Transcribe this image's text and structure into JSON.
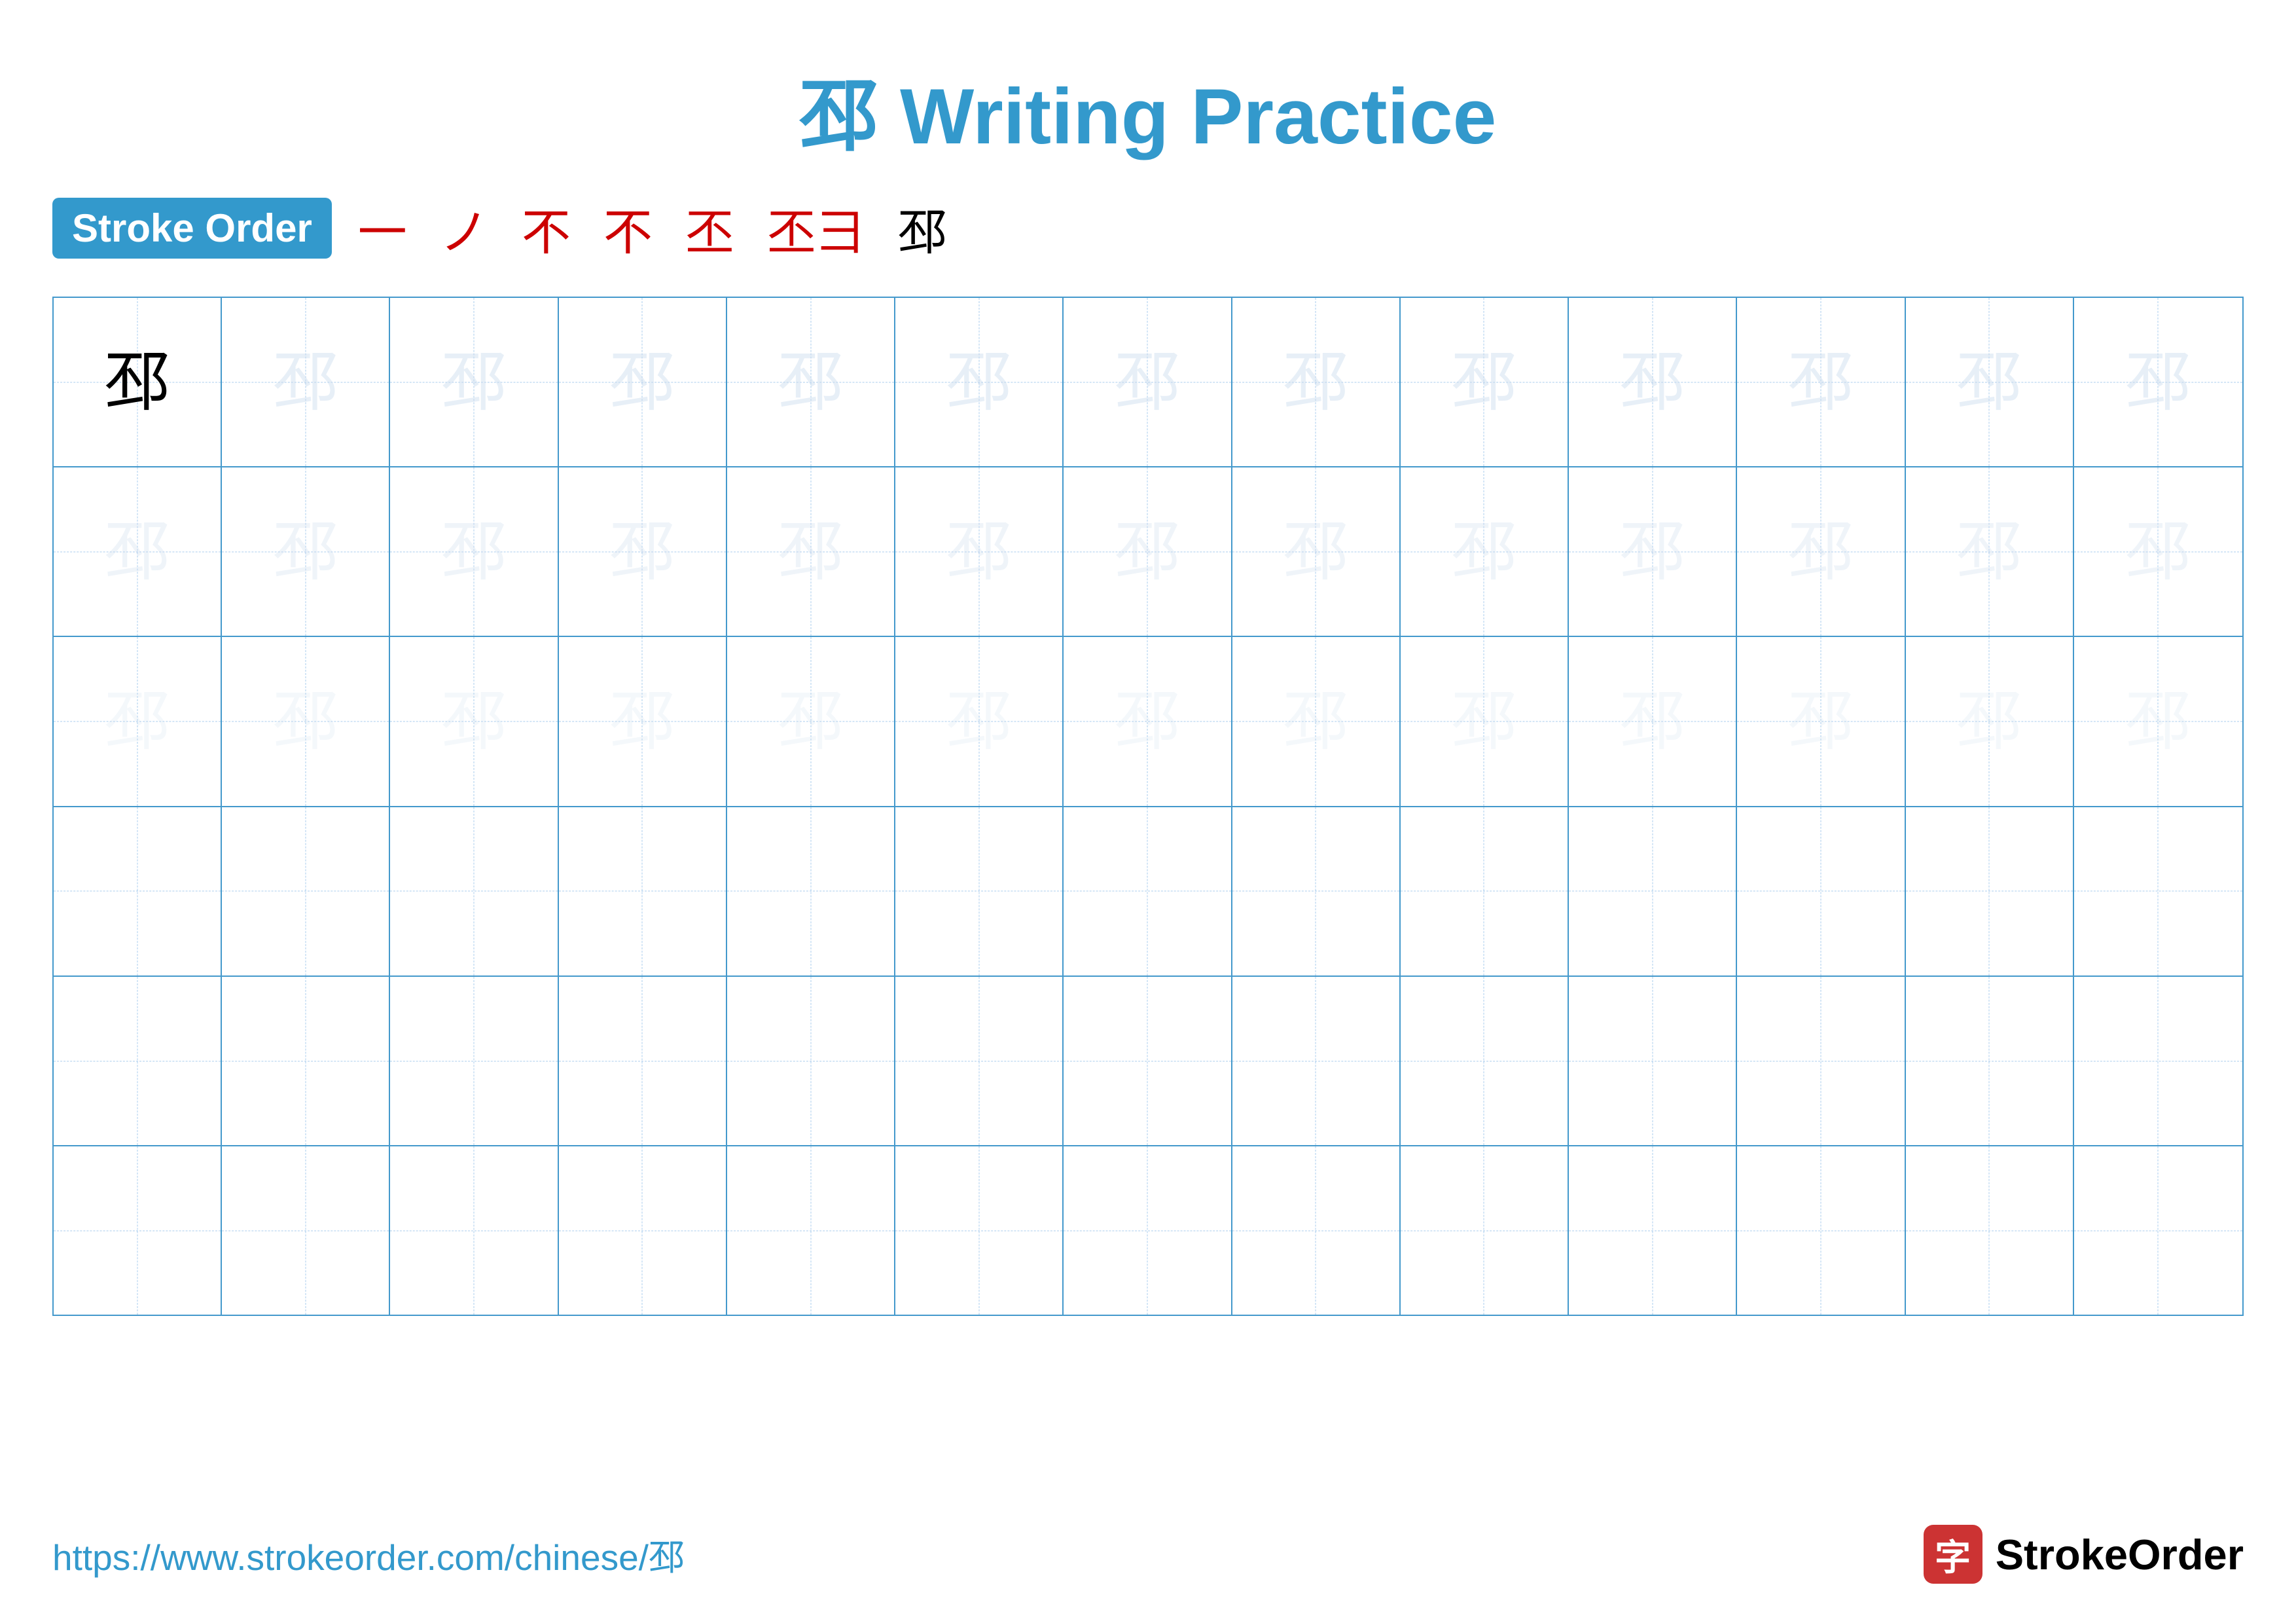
{
  "title": {
    "text": "邳 Writing Practice",
    "url": "https://www.strokeorder.com/chinese/邳"
  },
  "stroke_order": {
    "badge_label": "Stroke Order",
    "steps": [
      "一",
      "ノ",
      "不",
      "不",
      "丕",
      "丕彐",
      "邳"
    ]
  },
  "grid": {
    "rows": 6,
    "cols": 13,
    "character": "邳",
    "dark_row": 0,
    "dark_col": 0,
    "light_rows": [
      0,
      1,
      2
    ]
  },
  "footer": {
    "url": "https://www.strokeorder.com/chinese/邳",
    "logo_text": "StrokeOrder",
    "logo_char": "字"
  }
}
